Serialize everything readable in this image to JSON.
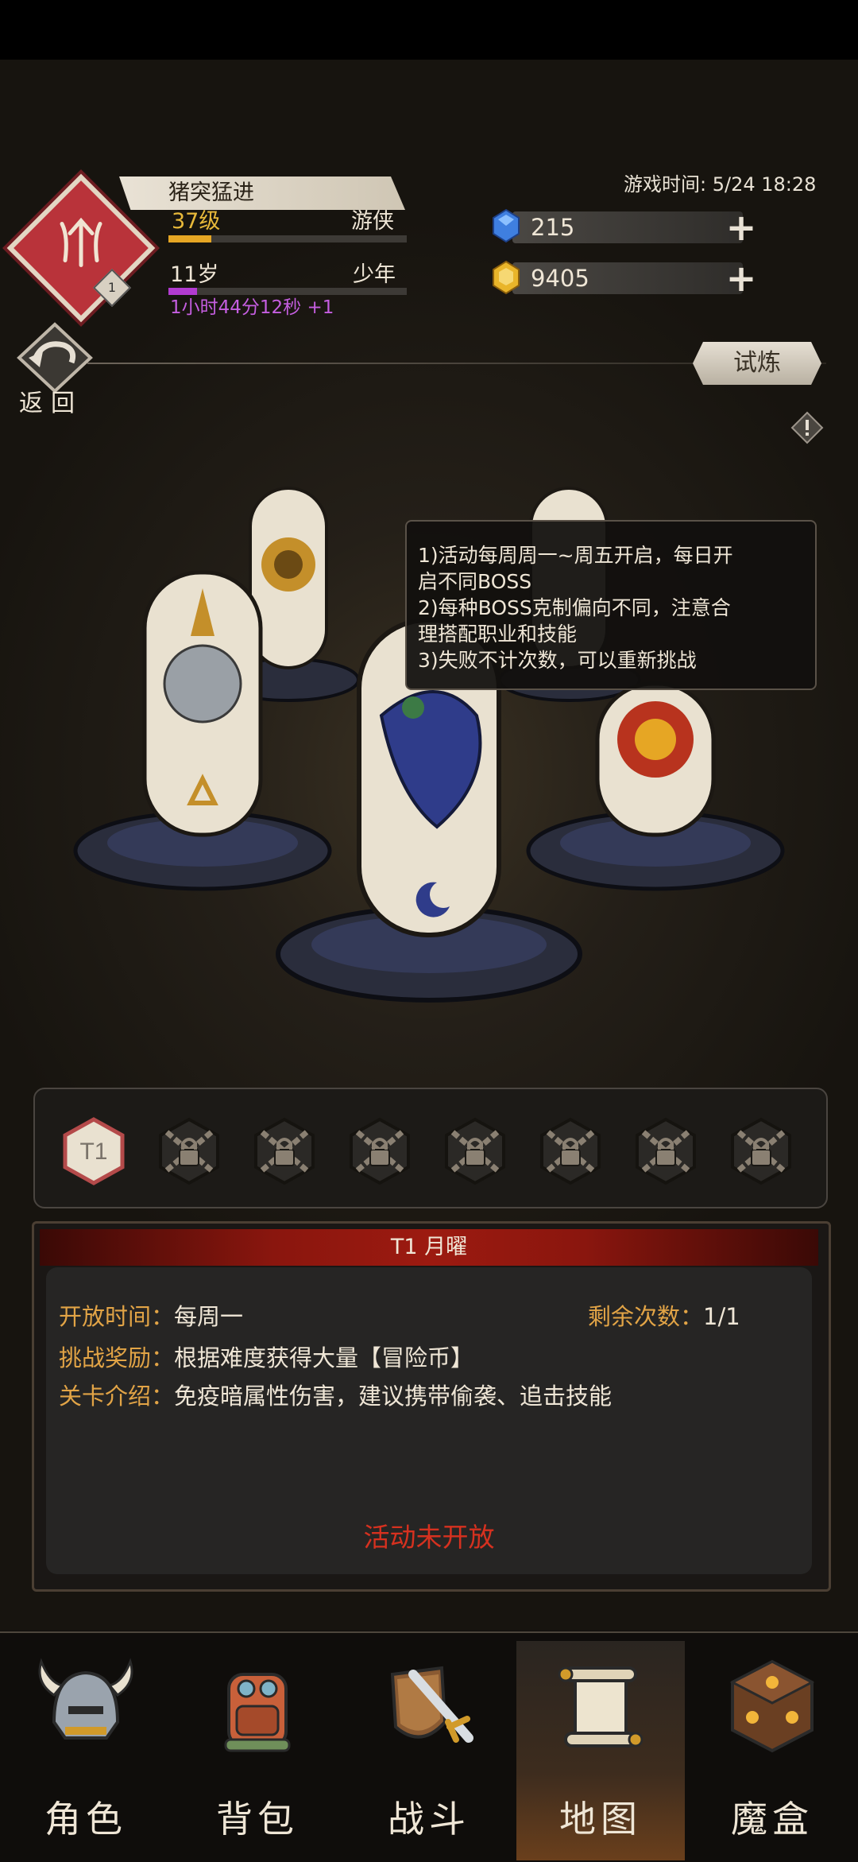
{
  "player": {
    "title": "猪突猛进",
    "level": "37级",
    "class": "游侠",
    "level_progress": 0.18,
    "age": "11岁",
    "stage": "少年",
    "age_progress": 0.12,
    "timer": "1小时44分12秒 +1",
    "emblem_badge": "1"
  },
  "game_time": "游戏时间: 5/24 18:28",
  "resources": {
    "gems": "215",
    "gold": "9405",
    "gem_color": "#3f7fe0",
    "gold_color": "#e9b52a"
  },
  "nav_top": {
    "back": "返回",
    "trial": "试炼"
  },
  "tooltip": [
    "1)活动每周周一~周五开启，每日开",
    "启不同BOSS",
    "2)每种BOSS克制偏向不同，注意合",
    "理搭配职业和技能",
    "3)失败不计次数，可以重新挑战"
  ],
  "tiers": [
    {
      "label": "T1",
      "locked": false
    },
    {
      "label": "",
      "locked": true
    },
    {
      "label": "",
      "locked": true
    },
    {
      "label": "",
      "locked": true
    },
    {
      "label": "",
      "locked": true
    },
    {
      "label": "",
      "locked": true
    },
    {
      "label": "",
      "locked": true
    },
    {
      "label": "",
      "locked": true
    }
  ],
  "detail": {
    "header": "T1 月曜",
    "open_time_label": "开放时间：",
    "open_time": "每周一",
    "remaining_label": "剩余次数：",
    "remaining": "1/1",
    "reward_label": "挑战奖励：",
    "reward": "根据难度获得大量【冒险币】",
    "intro_label": "关卡介绍：",
    "intro": "免疫暗属性伤害，建议携带偷袭、追击技能",
    "status": "活动未开放"
  },
  "bottom_nav": [
    {
      "label": "角色",
      "icon": "helmet-icon"
    },
    {
      "label": "背包",
      "icon": "backpack-icon"
    },
    {
      "label": "战斗",
      "icon": "sword-shield-icon"
    },
    {
      "label": "地图",
      "icon": "scroll-map-icon",
      "active": true
    },
    {
      "label": "魔盒",
      "icon": "magic-box-icon"
    }
  ],
  "colors": {
    "accent_red": "#9c1a10",
    "label_orange": "#e2a446",
    "status_red": "#d6311f"
  }
}
